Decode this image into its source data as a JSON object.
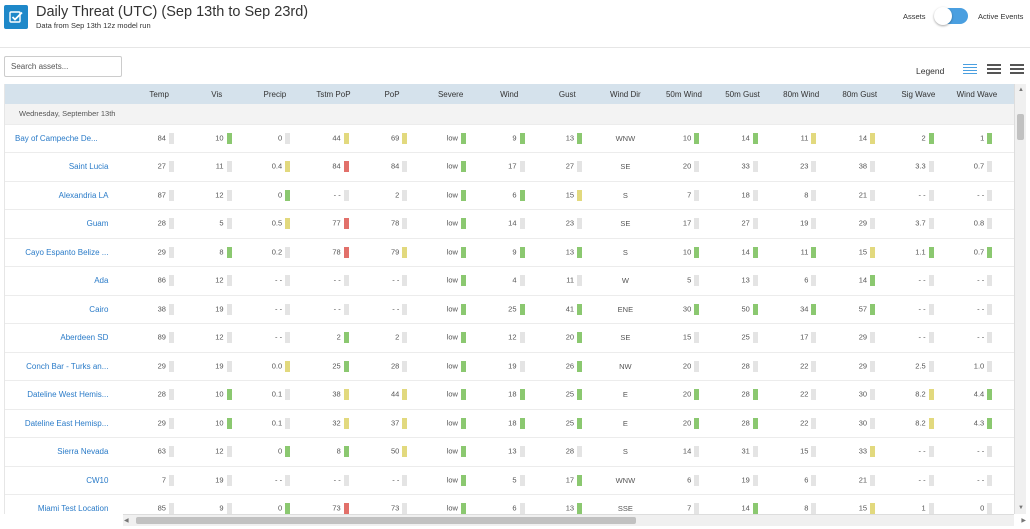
{
  "header": {
    "title": "Daily Threat (UTC) (Sep 13th to Sep 23rd)",
    "subtitle": "Data from Sep 13th 12z model run",
    "logo_icon": "checklist-icon",
    "toggle_left_label": "Assets",
    "toggle_right_label": "Active Events",
    "toggle_on": true
  },
  "search": {
    "placeholder": "Search assets..."
  },
  "legend": {
    "label": "Legend",
    "density_icons": [
      "density-compact-icon",
      "density-normal-icon",
      "density-comfortable-icon"
    ]
  },
  "colors": {
    "header_bg": "#d5e2ec",
    "accent": "#1e88c9",
    "toggle": "#4a9fe0",
    "bar_green": "#8bc870",
    "bar_yellow": "#e2d97e",
    "bar_red": "#e2706a",
    "bar_gray": "#e4e4e4",
    "link": "#2a7bc8"
  },
  "grid": {
    "columns": [
      "Temp",
      "Vis",
      "Precip",
      "Tstm PoP",
      "PoP",
      "Severe",
      "Wind",
      "Gust",
      "Wind Dir",
      "50m Wind",
      "50m Gust",
      "80m Wind",
      "80m Gust",
      "Sig Wave",
      "Wind Wave",
      "Wind Wa"
    ],
    "day_label": "Wednesday, September 13th",
    "rows": [
      {
        "loc": "Bay of Campeche De...",
        "cells": [
          [
            "84",
            "e"
          ],
          [
            "10",
            "g"
          ],
          [
            "0",
            "e"
          ],
          [
            "44",
            "y"
          ],
          [
            "69",
            "y"
          ],
          [
            "low",
            "g"
          ],
          [
            "9",
            "g"
          ],
          [
            "13",
            "g"
          ],
          [
            "WNW",
            ""
          ],
          [
            "10",
            "g"
          ],
          [
            "14",
            "g"
          ],
          [
            "11",
            "y"
          ],
          [
            "14",
            "y"
          ],
          [
            "2",
            "g"
          ],
          [
            "1",
            "g"
          ],
          [
            "WN",
            ""
          ]
        ]
      },
      {
        "loc": "Saint Lucia",
        "cells": [
          [
            "27",
            "e"
          ],
          [
            "11",
            "e"
          ],
          [
            "0.4",
            "y"
          ],
          [
            "84",
            "r"
          ],
          [
            "84",
            "e"
          ],
          [
            "low",
            "g"
          ],
          [
            "17",
            "e"
          ],
          [
            "27",
            "e"
          ],
          [
            "SE",
            ""
          ],
          [
            "20",
            "e"
          ],
          [
            "33",
            "e"
          ],
          [
            "23",
            "e"
          ],
          [
            "38",
            "e"
          ],
          [
            "3.3",
            "e"
          ],
          [
            "0.7",
            "e"
          ],
          [
            "E",
            ""
          ]
        ]
      },
      {
        "loc": "Alexandria LA",
        "cells": [
          [
            "87",
            "e"
          ],
          [
            "12",
            "e"
          ],
          [
            "0",
            "g"
          ],
          [
            "- -",
            "e"
          ],
          [
            "2",
            "e"
          ],
          [
            "low",
            "g"
          ],
          [
            "6",
            "g"
          ],
          [
            "15",
            "y"
          ],
          [
            "S",
            ""
          ],
          [
            "7",
            "e"
          ],
          [
            "18",
            "e"
          ],
          [
            "8",
            "e"
          ],
          [
            "21",
            "e"
          ],
          [
            "- -",
            "e"
          ],
          [
            "- -",
            "e"
          ],
          [
            "- -",
            ""
          ]
        ]
      },
      {
        "loc": "Guam",
        "cells": [
          [
            "28",
            "e"
          ],
          [
            "5",
            "e"
          ],
          [
            "0.5",
            "y"
          ],
          [
            "77",
            "r"
          ],
          [
            "78",
            "e"
          ],
          [
            "low",
            "g"
          ],
          [
            "14",
            "e"
          ],
          [
            "23",
            "e"
          ],
          [
            "SE",
            ""
          ],
          [
            "17",
            "e"
          ],
          [
            "27",
            "e"
          ],
          [
            "19",
            "e"
          ],
          [
            "29",
            "e"
          ],
          [
            "3.7",
            "e"
          ],
          [
            "0.8",
            "e"
          ],
          [
            "E",
            ""
          ]
        ]
      },
      {
        "loc": "Cayo Espanto Belize ...",
        "cells": [
          [
            "29",
            "e"
          ],
          [
            "8",
            "g"
          ],
          [
            "0.2",
            "e"
          ],
          [
            "78",
            "r"
          ],
          [
            "79",
            "y"
          ],
          [
            "low",
            "g"
          ],
          [
            "9",
            "g"
          ],
          [
            "13",
            "g"
          ],
          [
            "S",
            ""
          ],
          [
            "10",
            "g"
          ],
          [
            "14",
            "g"
          ],
          [
            "11",
            "g"
          ],
          [
            "15",
            "y"
          ],
          [
            "1.1",
            "g"
          ],
          [
            "0.7",
            "g"
          ],
          [
            "S",
            ""
          ]
        ]
      },
      {
        "loc": "Ada",
        "cells": [
          [
            "86",
            "e"
          ],
          [
            "12",
            "e"
          ],
          [
            "- -",
            "e"
          ],
          [
            "- -",
            "e"
          ],
          [
            "- -",
            "e"
          ],
          [
            "low",
            "g"
          ],
          [
            "4",
            "e"
          ],
          [
            "11",
            "e"
          ],
          [
            "W",
            ""
          ],
          [
            "5",
            "e"
          ],
          [
            "13",
            "e"
          ],
          [
            "6",
            "e"
          ],
          [
            "14",
            "g"
          ],
          [
            "- -",
            "e"
          ],
          [
            "- -",
            "e"
          ],
          [
            "- -",
            ""
          ]
        ]
      },
      {
        "loc": "Cairo",
        "cells": [
          [
            "38",
            "e"
          ],
          [
            "19",
            "e"
          ],
          [
            "- -",
            "e"
          ],
          [
            "- -",
            "e"
          ],
          [
            "- -",
            "e"
          ],
          [
            "low",
            "g"
          ],
          [
            "25",
            "g"
          ],
          [
            "41",
            "g"
          ],
          [
            "ENE",
            ""
          ],
          [
            "30",
            "g"
          ],
          [
            "50",
            "g"
          ],
          [
            "34",
            "g"
          ],
          [
            "57",
            "g"
          ],
          [
            "- -",
            "e"
          ],
          [
            "- -",
            "e"
          ],
          [
            "- -",
            ""
          ]
        ]
      },
      {
        "loc": "Aberdeen SD",
        "cells": [
          [
            "89",
            "e"
          ],
          [
            "12",
            "e"
          ],
          [
            "- -",
            "e"
          ],
          [
            "2",
            "g"
          ],
          [
            "2",
            "e"
          ],
          [
            "low",
            "g"
          ],
          [
            "12",
            "e"
          ],
          [
            "20",
            "g"
          ],
          [
            "SE",
            ""
          ],
          [
            "15",
            "e"
          ],
          [
            "25",
            "e"
          ],
          [
            "17",
            "e"
          ],
          [
            "29",
            "e"
          ],
          [
            "- -",
            "e"
          ],
          [
            "- -",
            "e"
          ],
          [
            "- -",
            ""
          ]
        ]
      },
      {
        "loc": "Conch Bar - Turks an...",
        "cells": [
          [
            "29",
            "e"
          ],
          [
            "19",
            "e"
          ],
          [
            "0.0",
            "y"
          ],
          [
            "25",
            "g"
          ],
          [
            "28",
            "e"
          ],
          [
            "low",
            "g"
          ],
          [
            "19",
            "e"
          ],
          [
            "26",
            "g"
          ],
          [
            "NW",
            ""
          ],
          [
            "20",
            "e"
          ],
          [
            "28",
            "e"
          ],
          [
            "22",
            "e"
          ],
          [
            "29",
            "e"
          ],
          [
            "2.5",
            "e"
          ],
          [
            "1.0",
            "e"
          ],
          [
            "WN",
            ""
          ]
        ]
      },
      {
        "loc": "Dateline West Hemis...",
        "cells": [
          [
            "28",
            "e"
          ],
          [
            "10",
            "g"
          ],
          [
            "0.1",
            "e"
          ],
          [
            "38",
            "y"
          ],
          [
            "44",
            "y"
          ],
          [
            "low",
            "g"
          ],
          [
            "18",
            "g"
          ],
          [
            "25",
            "g"
          ],
          [
            "E",
            ""
          ],
          [
            "20",
            "g"
          ],
          [
            "28",
            "g"
          ],
          [
            "22",
            "e"
          ],
          [
            "30",
            "e"
          ],
          [
            "8.2",
            "y"
          ],
          [
            "4.4",
            "g"
          ],
          [
            "E",
            ""
          ]
        ]
      },
      {
        "loc": "Dateline East Hemisp...",
        "cells": [
          [
            "29",
            "e"
          ],
          [
            "10",
            "g"
          ],
          [
            "0.1",
            "e"
          ],
          [
            "32",
            "y"
          ],
          [
            "37",
            "y"
          ],
          [
            "low",
            "g"
          ],
          [
            "18",
            "g"
          ],
          [
            "25",
            "g"
          ],
          [
            "E",
            ""
          ],
          [
            "20",
            "g"
          ],
          [
            "28",
            "g"
          ],
          [
            "22",
            "e"
          ],
          [
            "30",
            "e"
          ],
          [
            "8.2",
            "y"
          ],
          [
            "4.3",
            "g"
          ],
          [
            "E",
            ""
          ]
        ]
      },
      {
        "loc": "Sierra Nevada",
        "cells": [
          [
            "63",
            "e"
          ],
          [
            "12",
            "e"
          ],
          [
            "0",
            "g"
          ],
          [
            "8",
            "g"
          ],
          [
            "50",
            "y"
          ],
          [
            "low",
            "g"
          ],
          [
            "13",
            "e"
          ],
          [
            "28",
            "e"
          ],
          [
            "S",
            ""
          ],
          [
            "14",
            "e"
          ],
          [
            "31",
            "e"
          ],
          [
            "15",
            "e"
          ],
          [
            "33",
            "y"
          ],
          [
            "- -",
            "e"
          ],
          [
            "- -",
            "e"
          ],
          [
            "- -",
            ""
          ]
        ]
      },
      {
        "loc": "CW10",
        "cells": [
          [
            "7",
            "e"
          ],
          [
            "19",
            "e"
          ],
          [
            "- -",
            "e"
          ],
          [
            "- -",
            "e"
          ],
          [
            "- -",
            "e"
          ],
          [
            "low",
            "g"
          ],
          [
            "5",
            "e"
          ],
          [
            "17",
            "g"
          ],
          [
            "WNW",
            ""
          ],
          [
            "6",
            "e"
          ],
          [
            "19",
            "e"
          ],
          [
            "6",
            "e"
          ],
          [
            "21",
            "e"
          ],
          [
            "- -",
            "e"
          ],
          [
            "- -",
            "e"
          ],
          [
            "- -",
            ""
          ]
        ]
      },
      {
        "loc": "Miami Test Location",
        "cells": [
          [
            "85",
            "e"
          ],
          [
            "9",
            "e"
          ],
          [
            "0",
            "g"
          ],
          [
            "73",
            "r"
          ],
          [
            "73",
            "e"
          ],
          [
            "low",
            "g"
          ],
          [
            "6",
            "e"
          ],
          [
            "13",
            "g"
          ],
          [
            "SSE",
            ""
          ],
          [
            "7",
            "e"
          ],
          [
            "14",
            "g"
          ],
          [
            "8",
            "e"
          ],
          [
            "15",
            "y"
          ],
          [
            "1",
            "e"
          ],
          [
            "0",
            "e"
          ],
          [
            "E",
            ""
          ]
        ]
      }
    ]
  }
}
